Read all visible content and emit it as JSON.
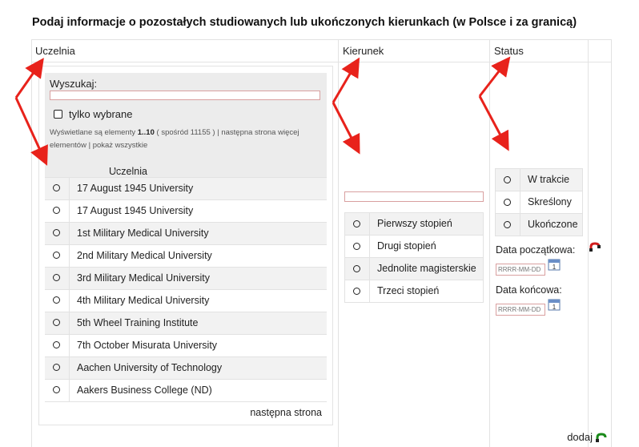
{
  "title": "Podaj informacje o pozostałych studiowanych lub ukończonych kierunkach (w Polsce i za granicą)",
  "columns": {
    "uczelnia": "Uczelnia",
    "kierunek": "Kierunek",
    "status": "Status"
  },
  "uczelnia_widget": {
    "search_label": "Wyszukaj:",
    "search_value": "",
    "only_selected_label": "tylko wybrane",
    "info": {
      "prefix": "Wyświetlane są elementy ",
      "range": "1..10",
      "middle": " ( spośród 11155 ) | następna strona więcej",
      "line2": "elementów | pokaż wszystkie"
    },
    "list_header": "Uczelnia",
    "items": [
      "17 August 1945 University",
      "17 August 1945 University",
      "1st Military Medical University",
      "2nd Military Medical University",
      "3rd Military Medical University",
      "4th Military Medical University",
      "5th Wheel Training Institute",
      "7th October Misurata University",
      "Aachen University of Technology",
      "Aakers Business College (ND)"
    ],
    "next_page": "następna strona"
  },
  "kierunek": {
    "input_value": "",
    "degrees": [
      "Pierwszy stopień",
      "Drugi stopień",
      "Jednolite magisterskie",
      "Trzeci stopień"
    ]
  },
  "status": {
    "options": [
      "W trakcie",
      "Skreślony",
      "Ukończone"
    ],
    "start_label": "Data początkowa:",
    "end_label": "Data końcowa:",
    "date_placeholder": "RRRR-MM-DD"
  },
  "add_label": "dodaj",
  "colors": {
    "arrow": "#e8221b",
    "input_border": "#d9a0a0",
    "header_bg": "#ececec",
    "add_icon": "#1a8a1a",
    "remove_icon": "#d01c1c"
  }
}
